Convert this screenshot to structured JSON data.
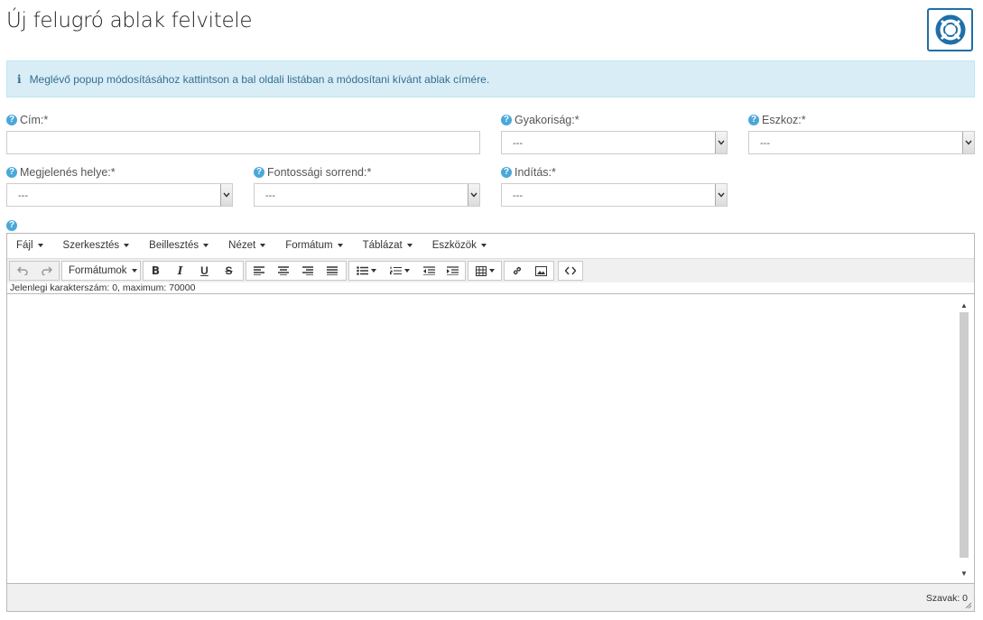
{
  "page": {
    "title": "Új felugró ablak felvitele"
  },
  "help_button": {
    "icon": "lifebuoy-icon"
  },
  "alert": {
    "text": "Meglévő popup módosításához kattintson a bal oldali listában a módosítani kívánt ablak címére."
  },
  "form": {
    "title": {
      "label": "Cím:*",
      "value": ""
    },
    "frequency": {
      "label": "Gyakoriság:*",
      "value": "---"
    },
    "device": {
      "label": "Eszkoz:*",
      "value": "---"
    },
    "location": {
      "label": "Megjelenés helye:*",
      "value": "---"
    },
    "priority": {
      "label": "Fontossági sorrend:*",
      "value": "---"
    },
    "start": {
      "label": "Indítás:*",
      "value": "---"
    }
  },
  "editor": {
    "menu": [
      "Fájl",
      "Szerkesztés",
      "Beillesztés",
      "Nézet",
      "Formátum",
      "Táblázat",
      "Eszközök"
    ],
    "formats_label": "Formátumok",
    "char_count": "Jelenlegi karakterszám: 0, maximum: 70000",
    "word_count": "Szavak: 0"
  },
  "colors": {
    "accent": "#1f6fa8",
    "help": "#4aa8d8",
    "alert_bg": "#d9edf7",
    "alert_text": "#31708f"
  }
}
